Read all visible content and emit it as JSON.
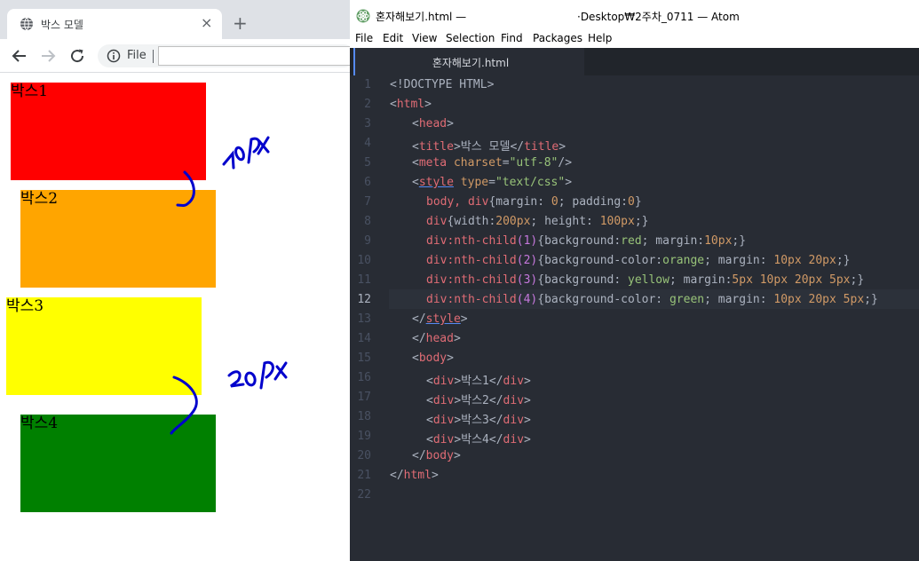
{
  "browser": {
    "tab_title": "박스 모델",
    "tab_close": "×",
    "new_tab": "+",
    "omnibox_label": "File",
    "boxes": [
      {
        "label": "박스1",
        "color": "#ff0000"
      },
      {
        "label": "박스2",
        "color": "#ffa500"
      },
      {
        "label": "박스3",
        "color": "#ffff00"
      },
      {
        "label": "박스4",
        "color": "#008000"
      }
    ],
    "annotation_color": "#0000cc"
  },
  "atom": {
    "title_left": "혼자해보기.html —",
    "title_right": "·Desktop₩2주차_0711 — Atom",
    "menu": [
      "File",
      "Edit",
      "View",
      "Selection",
      "Find",
      "Packages",
      "Help"
    ],
    "tab_label": "혼자해보기.html",
    "active_line": 12,
    "lines": [
      "<!DOCTYPE HTML>",
      "<html>",
      "<head>",
      "<title>박스 모델</title>",
      "<meta charset=\"utf-8\"/>",
      "<style type=\"text/css\">",
      "body, div{margin: 0; padding:0}",
      "div{width:200px; height: 100px;}",
      "div:nth-child(1){background:red; margin:10px;}",
      "div:nth-child(2){background-color:orange; margin: 10px 20px;}",
      "div:nth-child(3){background: yellow; margin:5px 10px 20px 5px;}",
      "div:nth-child(4){background-color: green; margin: 10px 20px 5px;}",
      "</style>",
      "</head>",
      "<body>",
      "<div>박스1</div>",
      "<div>박스2</div>",
      "<div>박스3</div>",
      "<div>박스4</div>",
      "</body>",
      "</html>",
      ""
    ]
  }
}
